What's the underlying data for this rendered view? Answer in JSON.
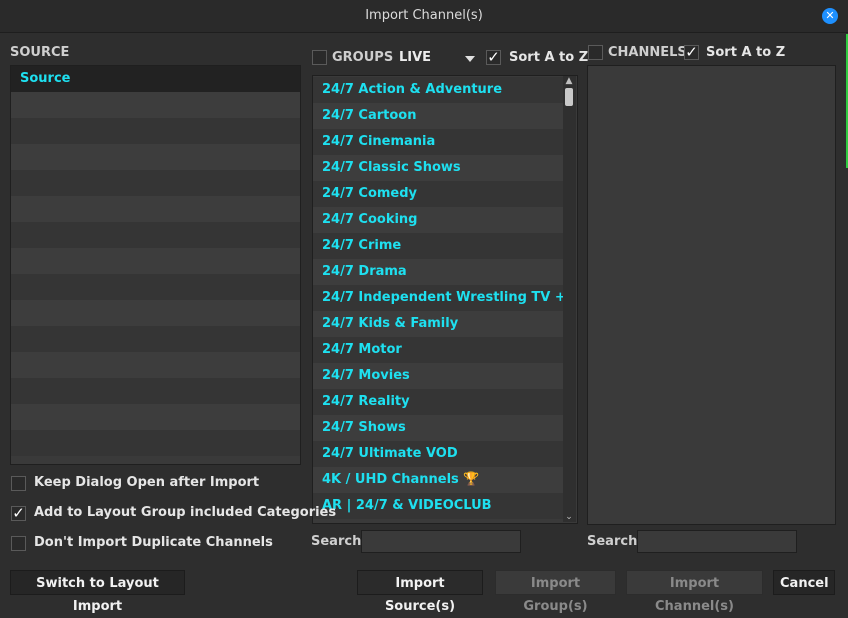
{
  "window": {
    "title": "Import Channel(s)"
  },
  "source": {
    "label": "SOURCE",
    "items": [
      "Source"
    ]
  },
  "groups": {
    "label": "GROUPS",
    "combo_value": "LIVE",
    "sort_label": "Sort A to Z",
    "items": [
      "24/7 Action & Adventure",
      "24/7 Cartoon",
      "24/7 Cinemania",
      "24/7 Classic Shows",
      "24/7 Comedy",
      "24/7 Cooking",
      "24/7 Crime",
      "24/7 Drama",
      "24/7 Independent Wrestling TV +",
      "24/7 Kids & Family",
      "24/7 Motor",
      "24/7 Movies",
      "24/7 Reality",
      "24/7 Shows",
      "24/7 Ultimate VOD",
      "4K / UHD Channels 🏆",
      "AR | 24/7 & VIDEOCLUB"
    ]
  },
  "channels": {
    "label": "CHANNELS",
    "sort_label": "Sort A to Z"
  },
  "options": {
    "keep_open": "Keep Dialog Open after Import",
    "add_layout": "Add to Layout Group included Categories",
    "no_duplicates": "Don't Import Duplicate Channels"
  },
  "search": {
    "label": "Search"
  },
  "buttons": {
    "switch_layout": "Switch to Layout Import",
    "import_sources": "Import Source(s)",
    "import_groups": "Import Group(s)",
    "import_channels": "Import Channel(s)",
    "cancel": "Cancel"
  }
}
